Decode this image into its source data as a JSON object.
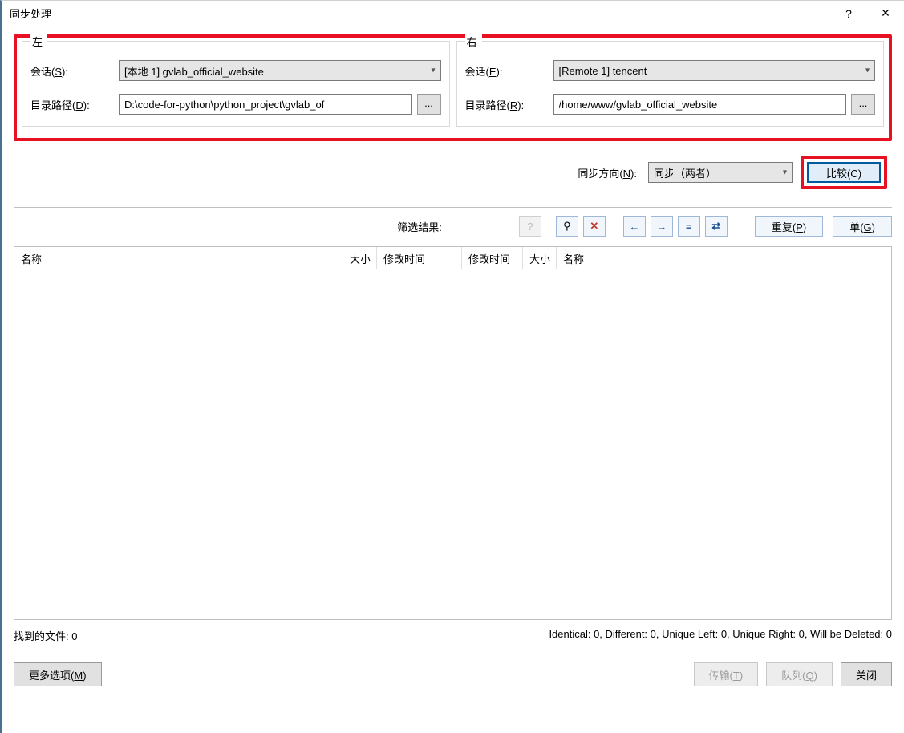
{
  "title": "同步处理",
  "help_glyph": "?",
  "close_glyph": "✕",
  "left": {
    "legend": "左",
    "session_label": "会话(S):",
    "session_value": "[本地 1] gvlab_official_website",
    "path_label": "目录路径(D):",
    "path_value": "D:\\code-for-python\\python_project\\gvlab_of",
    "browse": "..."
  },
  "right": {
    "legend": "右",
    "session_label": "会话(E):",
    "session_value": "[Remote 1] tencent",
    "path_label": "目录路径(R):",
    "path_value": "/home/www/gvlab_official_website",
    "browse": "..."
  },
  "sync": {
    "direction_label": "同步方向(N):",
    "direction_value": "同步（两者）",
    "compare": "比较(C)"
  },
  "filter": {
    "label": "筛选结果:",
    "question": "?",
    "pin": "⚲",
    "x": "✕",
    "left_arrow": "←",
    "right_arrow": "→",
    "eq": "=",
    "diff": "⇄",
    "repeat": "重复(P)",
    "single": "单(G)"
  },
  "table": {
    "name": "名称",
    "size": "大小",
    "mtime": "修改时间"
  },
  "found": {
    "left": "找到的文件: 0",
    "right": "Identical: 0, Different: 0, Unique Left: 0, Unique Right: 0, Will be Deleted: 0"
  },
  "bottom": {
    "more": "更多选项(M)",
    "transfer": "传输(T)",
    "queue": "队列(Q)",
    "close": "关闭"
  }
}
